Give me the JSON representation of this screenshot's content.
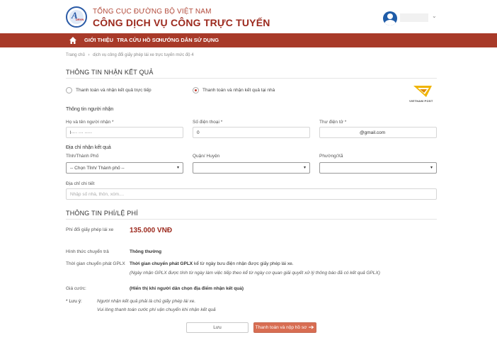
{
  "header": {
    "agency": "TỔNG CỤC ĐƯỜNG BỘ VIỆT NAM",
    "portal": "CÔNG DỊCH VỤ CÔNG TRỰC TUYẾN",
    "logo_text": "DRVN",
    "user_icon": "user-avatar-icon",
    "caret_glyph": "⌄"
  },
  "nav": {
    "items": [
      "GIỚI THIỆU",
      "TRA CỨU HỒ SƠ",
      "HƯỚNG DẪN SỬ DỤNG"
    ]
  },
  "breadcrumb": {
    "home": "Trang chủ",
    "separator": "›",
    "current": "dịch vụ công đổi giấy phép lái xe trực tuyến mức độ 4"
  },
  "receive": {
    "title": "THÔNG TIN NHẬN KẾT QUẢ",
    "option_direct": "Thanh toán và nhận kết quả trực tiếp",
    "option_home": "Thanh toán và nhận kết quả tại nhà",
    "selected": "home",
    "partner_logo": "VIETNAM POST"
  },
  "recipient": {
    "title": "Thông tin người nhận",
    "name_label": "Họ và tên người nhận *",
    "name_value": "l···· ··· ·····",
    "phone_label": "Số điện thoại *",
    "phone_value": "0",
    "email_label": "Thư điện tử *",
    "email_value": "@gmail.com"
  },
  "address": {
    "title": "Địa chỉ nhận kết quả",
    "province_label": "Tỉnh/Thành Phố",
    "province_value": "-- Chọn Tỉnh/ Thành phố --",
    "district_label": "Quận/ Huyện",
    "ward_label": "Phường/Xã",
    "detail_label": "Địa chỉ chi tiết",
    "detail_placeholder": "Nhập số nhà, thôn, xóm....",
    "caret": "▾"
  },
  "fees": {
    "title": "THÔNG TIN PHÍ/LỆ PHÍ",
    "license_fee_label": "Phí đổi giấy phép lái xe",
    "license_fee_value": "135.000 VNĐ",
    "shipping_method_label": "Hình thức chuyển trả",
    "shipping_method_value": "Thông thường",
    "delivery_time_label": "Thời gian chuyển phát GPLX",
    "delivery_time_bold": "Thời gian chuyển phát GPLX",
    "delivery_time_text": " kể từ ngày bưu điện nhận được giấy phép lái xe.",
    "delivery_time_note": "(Ngày nhận GPLX được tính từ ngày làm việc tiếp theo kể từ ngày cơ quan giải quyết xử lý thông báo đã có kết quả GPLX)",
    "postage_label": "Giá cước:",
    "postage_value": "(Hiển thị khi người dân chọn địa điểm nhận kết quả)",
    "note_label": "* Lưu ý:",
    "note_1": "Người nhận kết quả phải là chủ giấy phép lái xe.",
    "note_2": "Vui lòng thanh toán cước phí vận chuyển khi nhận kết quả"
  },
  "actions": {
    "save": "Lưu",
    "submit": "Thanh toán và nộp hồ sơ",
    "submit_icon": "arrow-right-icon"
  },
  "colors": {
    "brand": "#a83a29",
    "accent": "#d86d52",
    "fee": "#9c2a1e"
  }
}
